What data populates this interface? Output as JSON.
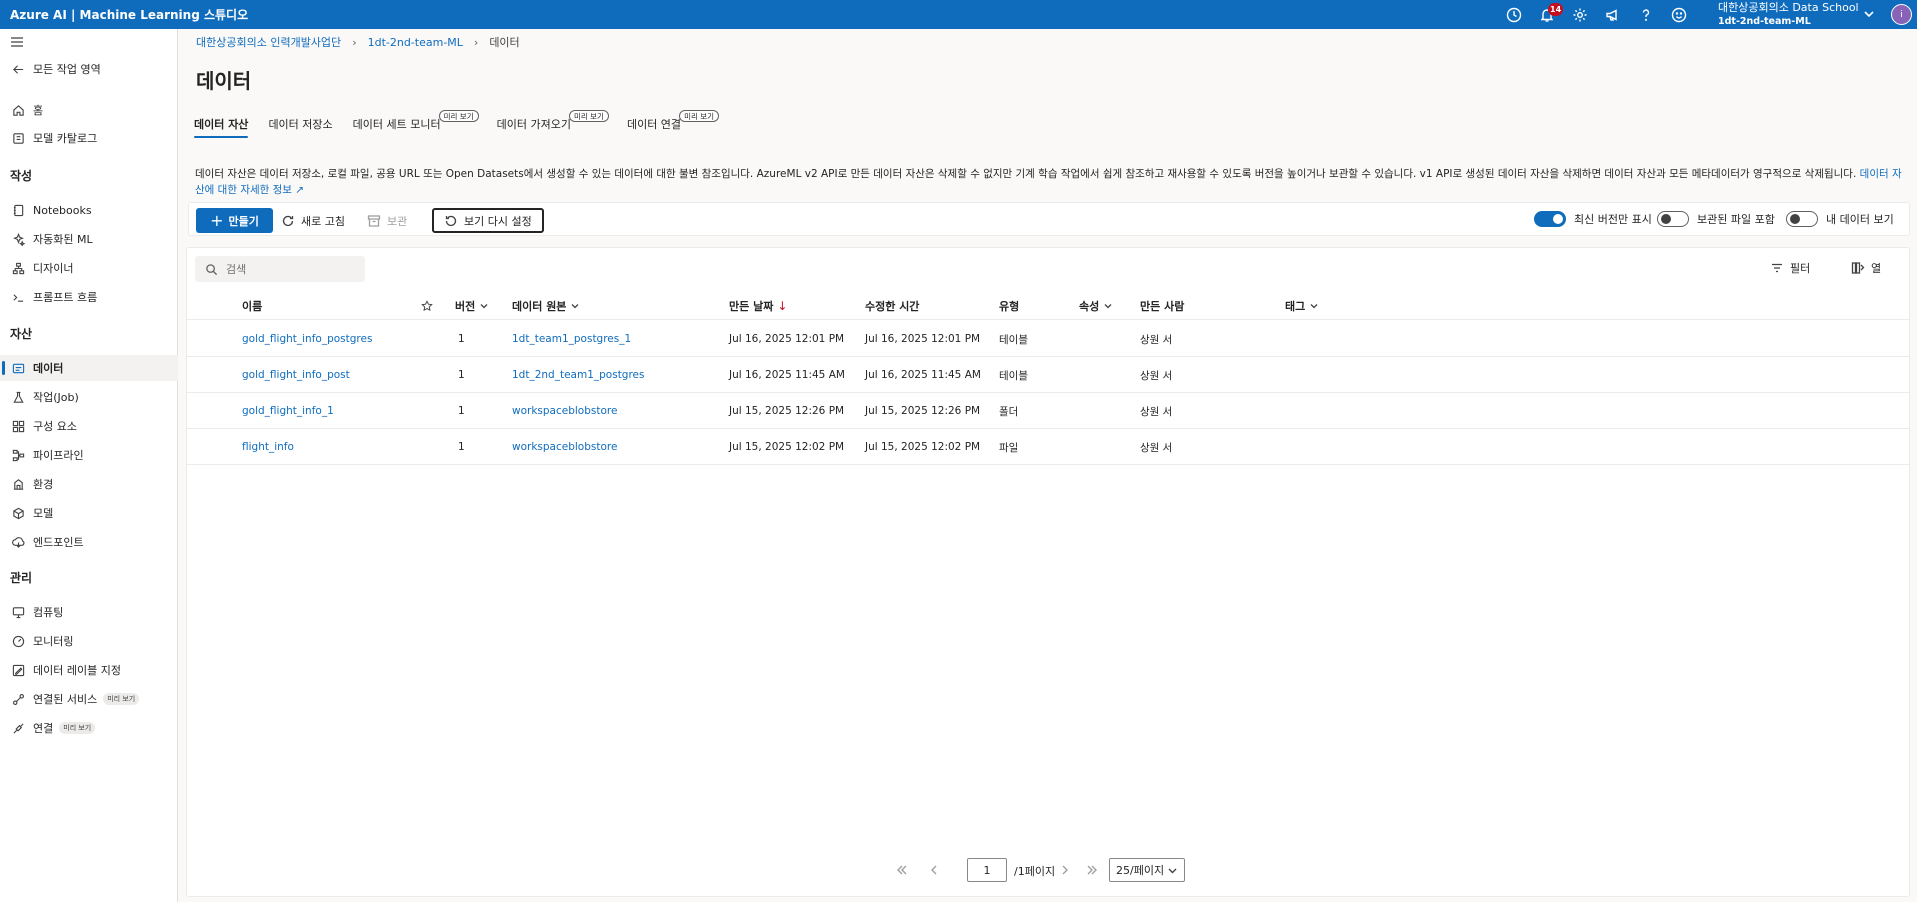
{
  "topbar": {
    "title": "Azure AI | Machine Learning 스튜디오",
    "notification_count": "14",
    "account_name": "대한상공회의소 Data School",
    "workspace_name": "1dt-2nd-team-ML",
    "avatar_initial": "i",
    "icons": [
      "clock-icon",
      "bell-icon",
      "gear-icon",
      "megaphone-icon",
      "help-icon",
      "smiley-icon"
    ]
  },
  "sidebar": {
    "back_label": "모든 작업 영역",
    "top_items": [
      {
        "label": "홈",
        "icon": "home-icon"
      },
      {
        "label": "모델 카탈로그",
        "icon": "catalog-icon"
      }
    ],
    "sections": {
      "author": "작성",
      "assets": "자산",
      "manage": "관리"
    },
    "author_items": [
      {
        "label": "Notebooks",
        "icon": "notebook-icon"
      },
      {
        "label": "자동화된 ML",
        "icon": "automl-icon"
      },
      {
        "label": "디자이너",
        "icon": "designer-icon"
      },
      {
        "label": "프롬프트 흐름",
        "icon": "prompt-flow-icon"
      }
    ],
    "asset_items": [
      {
        "label": "데이터",
        "icon": "data-icon"
      },
      {
        "label": "작업(Job)",
        "icon": "job-icon"
      },
      {
        "label": "구성 요소",
        "icon": "components-icon"
      },
      {
        "label": "파이프라인",
        "icon": "pipeline-icon"
      },
      {
        "label": "환경",
        "icon": "environment-icon"
      },
      {
        "label": "모델",
        "icon": "model-icon"
      },
      {
        "label": "엔드포인트",
        "icon": "endpoint-icon"
      }
    ],
    "manage_items": [
      {
        "label": "컴퓨팅",
        "icon": "compute-icon"
      },
      {
        "label": "모니터링",
        "icon": "monitoring-icon"
      },
      {
        "label": "데이터 레이블 지정",
        "icon": "labeling-icon"
      },
      {
        "label": "연결된 서비스",
        "icon": "linked-services-icon",
        "chip": "미리 보기"
      },
      {
        "label": "연결",
        "icon": "connection-icon",
        "chip": "미리 보기"
      }
    ]
  },
  "breadcrumb": {
    "items": [
      "대한상공회의소 인력개발사업단",
      "1dt-2nd-team-ML",
      "데이터"
    ]
  },
  "page_title": "데이터",
  "tabs": [
    {
      "label": "데이터 자산",
      "active": true,
      "chip": ""
    },
    {
      "label": "데이터 저장소",
      "active": false,
      "chip": ""
    },
    {
      "label": "데이터 세트 모니터",
      "active": false,
      "chip": "미리 보기"
    },
    {
      "label": "데이터 가져오기",
      "active": false,
      "chip": "미리 보기"
    },
    {
      "label": "데이터 연결",
      "active": false,
      "chip": "미리 보기"
    }
  ],
  "description": {
    "text": "데이터 자산은 데이터 저장소, 로컬 파일, 공용 URL 또는 Open Datasets에서 생성할 수 있는 데이터에 대한 불변 참조입니다. AzureML v2 API로 만든 데이터 자산은 삭제할 수 없지만 기계 학습 작업에서 쉽게 참조하고 재사용할 수 있도록 버전을 높이거나 보관할 수 있습니다. v1 API로 생성된 데이터 자산을 삭제하면 데이터 자산과 모든 메타데이터가 영구적으로 삭제됩니다.",
    "link": "데이터 자산에 대한 자세한 정보"
  },
  "toolbar": {
    "create_label": "만들기",
    "refresh_label": "새로 고침",
    "archive_label": "보관",
    "reset_view_label": "보기 다시 설정",
    "toggles": [
      {
        "label": "최신 버전만 표시",
        "on": true
      },
      {
        "label": "보관된 파일 포함",
        "on": false
      },
      {
        "label": "내 데이터 보기",
        "on": false
      }
    ]
  },
  "grid": {
    "search_placeholder": "검색",
    "filter_label": "필터",
    "columns_label": "열",
    "headers": {
      "name": "이름",
      "version": "버전",
      "source": "데이터 원본",
      "created": "만든 날짜",
      "modified": "수정한 시간",
      "type": "유형",
      "properties": "속성",
      "created_by": "만든 사람",
      "tags": "태그"
    },
    "rows": [
      {
        "name": "gold_flight_info_postgres",
        "version": "1",
        "source": "1dt_team1_postgres_1",
        "created": "Jul 16, 2025 12:01 PM",
        "modified": "Jul 16, 2025 12:01 PM",
        "type": "테이블",
        "created_by": "상원 서"
      },
      {
        "name": "gold_flight_info_post",
        "version": "1",
        "source": "1dt_2nd_team1_postgres",
        "created": "Jul 16, 2025 11:45 AM",
        "modified": "Jul 16, 2025 11:45 AM",
        "type": "테이블",
        "created_by": "상원 서"
      },
      {
        "name": "gold_flight_info_1",
        "version": "1",
        "source": "workspaceblobstore",
        "created": "Jul 15, 2025 12:26 PM",
        "modified": "Jul 15, 2025 12:26 PM",
        "type": "폴더",
        "created_by": "상원 서"
      },
      {
        "name": "flight_info",
        "version": "1",
        "source": "workspaceblobstore",
        "created": "Jul 15, 2025 12:02 PM",
        "modified": "Jul 15, 2025 12:02 PM",
        "type": "파일",
        "created_by": "상원 서"
      }
    ]
  },
  "pager": {
    "page": "1",
    "total": "/1페이지",
    "per_page": "25/페이지"
  },
  "colors": {
    "accent": "#0f6cbd",
    "badge": "#c50f1f"
  }
}
